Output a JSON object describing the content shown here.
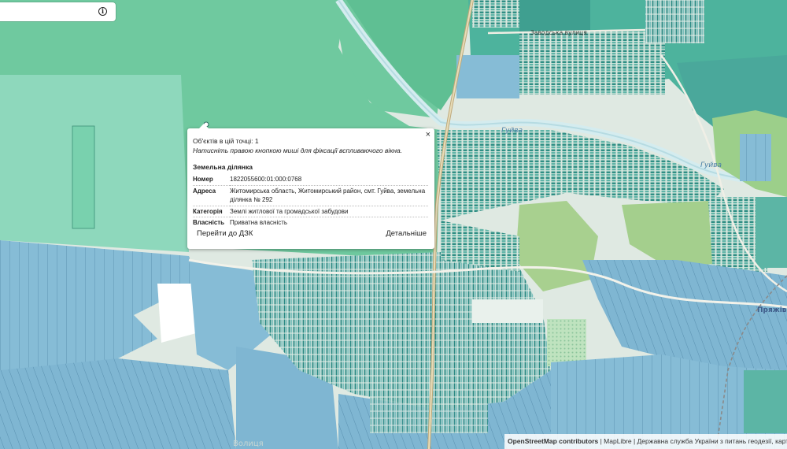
{
  "search": {
    "info_icon": "info-icon"
  },
  "map": {
    "labels": {
      "street": "Заводська вулиця",
      "river1": "Гуйва",
      "river2": "Гуйва",
      "village": "Пряжів",
      "bottom": "Волиця"
    },
    "colors": {
      "forest": "#6fc99f",
      "meadow": "#8fd8bc",
      "parcel_blue": "#86bcd6",
      "parcel_teal": "#4aa89b",
      "residential": "#2f8e84",
      "field_light": "#c0dcc7",
      "grass": "#a8d08f",
      "river": "#d4ecef",
      "road": "#e4e4d4"
    }
  },
  "popup": {
    "close": "×",
    "count": "Об'єктів в цій точці: 1",
    "hint": "Натисніть правою кнопкою миші для фіксації вспливаючого вікна.",
    "section": "Земельна ділянка",
    "rows": [
      {
        "key": "Номер",
        "value": "1822055600:01:000:0768"
      },
      {
        "key": "Адреса",
        "value": "Житомирська область, Житомирський район, смт. Гуйва, земельна ділянка № 292"
      },
      {
        "key": "Категорія",
        "value": "Землі житлової та громадської забудови"
      },
      {
        "key": "Власність",
        "value": "Приватна власність"
      }
    ],
    "goto": "Перейти до ДЗК",
    "details": "Детальніше"
  },
  "attribution": {
    "osm": "OpenStreetMap contributors",
    "sep1": " | ",
    "maplibre": "MapLibre",
    "sep2": " | ",
    "agency": "Державна служба України з питань геодезії, картографії та кадастру"
  }
}
